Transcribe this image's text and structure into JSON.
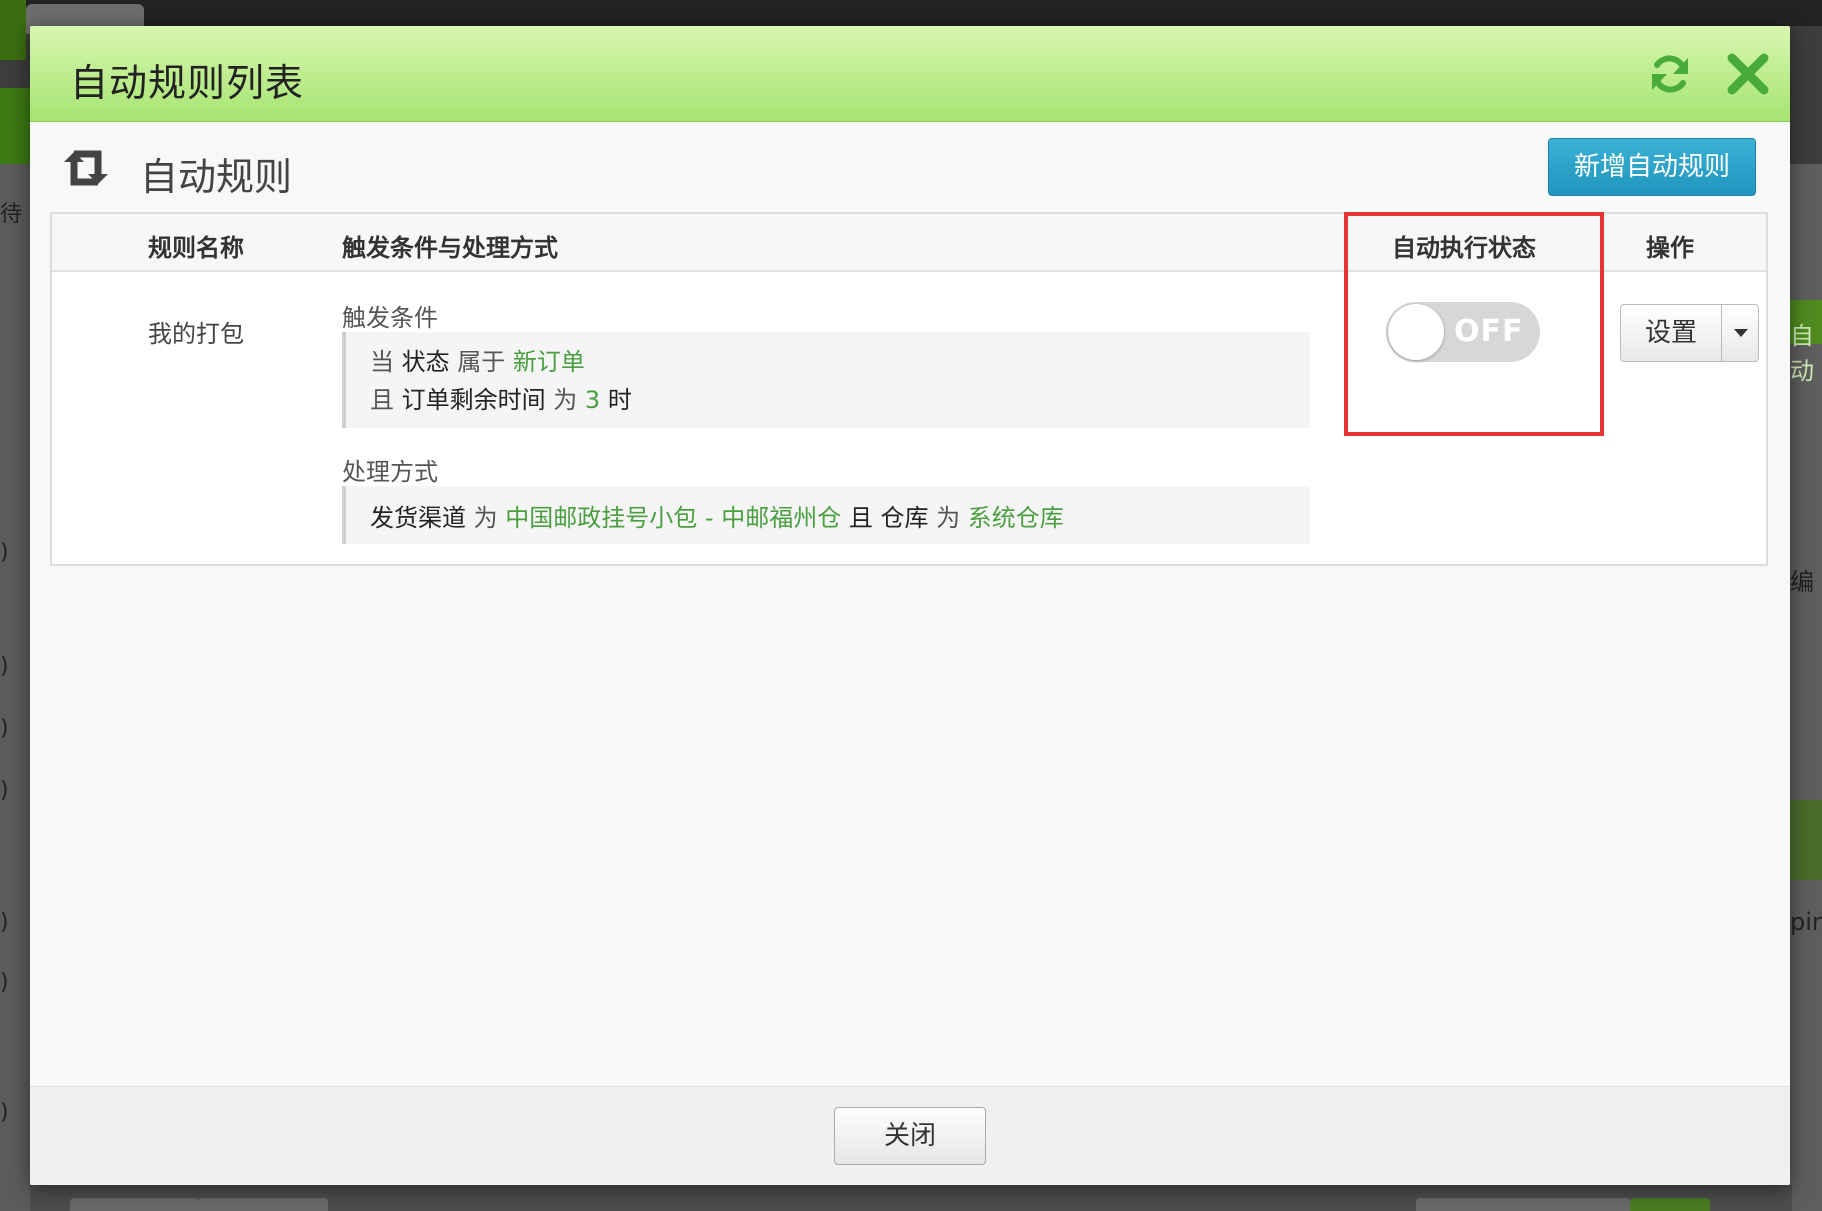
{
  "background": {
    "left_texts": [
      "待",
      ")",
      ")",
      ")",
      ")",
      ")",
      ")",
      ")"
    ],
    "right_texts": [
      "自动",
      "编",
      "ping"
    ],
    "tab_label": ""
  },
  "modal": {
    "title": "自动规则列表",
    "header_icons": [
      "refresh-icon",
      "close-icon"
    ],
    "sub_title": "自动规则",
    "new_rule_button": "新增自动规则",
    "table": {
      "columns": [
        "规则名称",
        "触发条件与处理方式",
        "自动执行状态",
        "操作"
      ],
      "rows": [
        {
          "name": "我的打包",
          "trigger_label": "触发条件",
          "trigger_lines": [
            {
              "prefix": "当",
              "field": "状态",
              "op": "属于",
              "value": "新订单",
              "suffix": ""
            },
            {
              "prefix": "且",
              "field": "订单剩余时间",
              "op": "为",
              "value": "3",
              "suffix": "时"
            }
          ],
          "handle_label": "处理方式",
          "handle_line": {
            "field1": "发货渠道",
            "op1": "为",
            "value1": "中国邮政挂号小包 - 中邮福州仓",
            "joiner": "且",
            "field2": "仓库",
            "op2": "为",
            "value2": "系统仓库"
          },
          "status": "OFF",
          "status_on": false,
          "action_button": "设置"
        }
      ]
    },
    "close_button": "关闭"
  },
  "colors": {
    "header_gradient_top": "#d8f7b0",
    "header_gradient_bottom": "#a6e472",
    "primary_button": "#2aa3cc",
    "value_green": "#4aa040",
    "highlight_red": "#e53636",
    "toggle_off": "#d7d7d7"
  }
}
